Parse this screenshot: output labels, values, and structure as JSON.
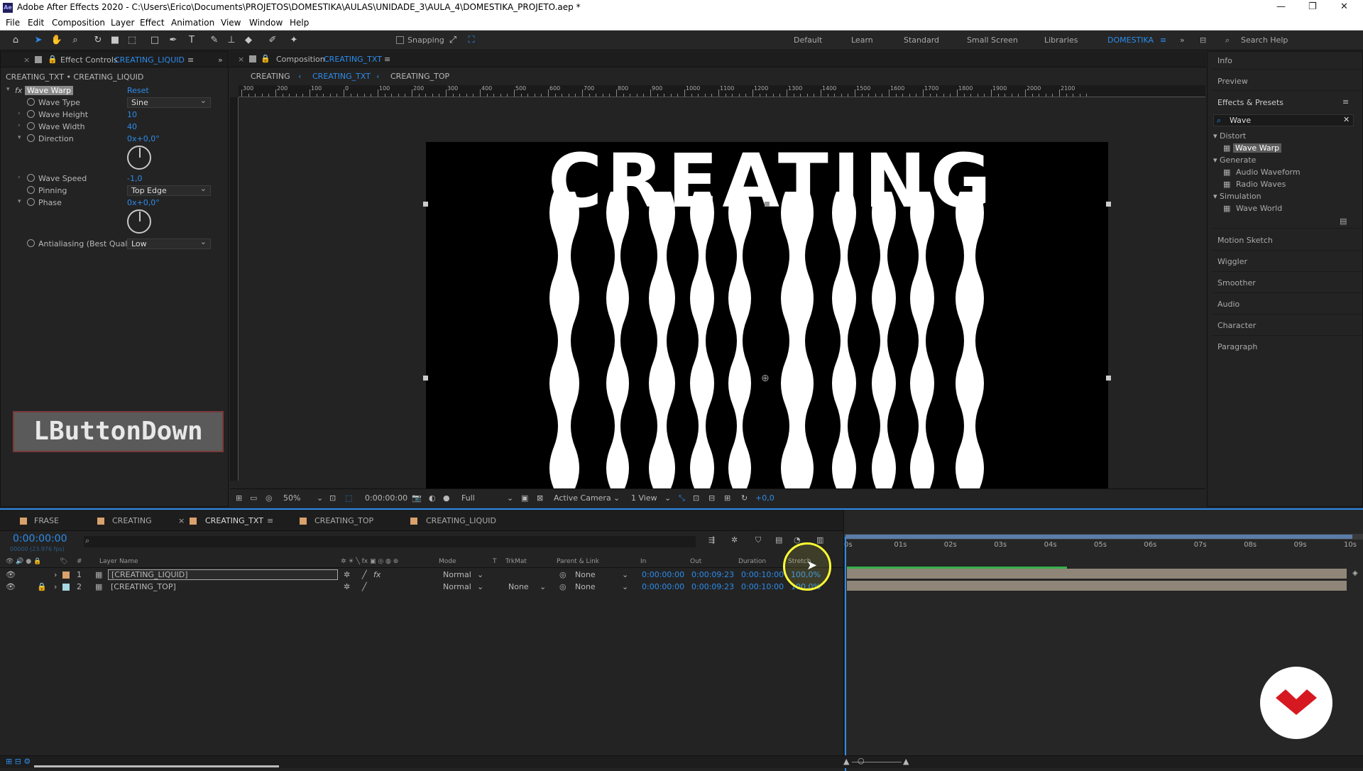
{
  "app": {
    "title": "Adobe After Effects 2020 - C:\\Users\\Erico\\Documents\\PROJETOS\\DOMESTIKA\\AULAS\\UNIDADE_3\\AULA_4\\DOMESTIKA_PROJETO.aep *",
    "icon_label": "Ae"
  },
  "menu": [
    "File",
    "Edit",
    "Composition",
    "Layer",
    "Effect",
    "Animation",
    "View",
    "Window",
    "Help"
  ],
  "toolbar": {
    "snapping": "Snapping",
    "workspaces": [
      "Default",
      "Learn",
      "Standard",
      "Small Screen",
      "Libraries",
      "DOMESTIKA"
    ],
    "search_help": "Search Help"
  },
  "effect_controls": {
    "tab_prefix": "Effect Controls",
    "tab_layer": "CREATING_LIQUID",
    "header": "CREATING_TXT • CREATING_LIQUID",
    "effect_name": "Wave Warp",
    "reset": "Reset",
    "fx": "fx",
    "props": [
      {
        "label": "Wave Type",
        "value": "Sine"
      },
      {
        "label": "Wave Height",
        "value": "10"
      },
      {
        "label": "Wave Width",
        "value": "40"
      },
      {
        "label": "Direction",
        "value": "0x+0,0°"
      },
      {
        "label": "Wave Speed",
        "value": "-1,0"
      },
      {
        "label": "Pinning",
        "value": "Top Edge"
      },
      {
        "label": "Phase",
        "value": "0x+0,0°"
      },
      {
        "label": "Antialiasing (Best Quali",
        "value": "Low"
      }
    ]
  },
  "overlay_label": "LButtonDown",
  "composition": {
    "tab_prefix": "Composition",
    "tab_name": "CREATING_TXT",
    "breadcrumbs": [
      "CREATING",
      "CREATING_TXT",
      "CREATING_TOP"
    ],
    "ruler_labels": [
      "300",
      "200",
      "100",
      "0",
      "100",
      "200",
      "300",
      "400",
      "500",
      "600",
      "700",
      "800",
      "900",
      "1000",
      "1100",
      "1200",
      "1300",
      "1400",
      "1500",
      "1600",
      "1700",
      "1800",
      "1900",
      "2000",
      "2100"
    ],
    "canvas_text": "CREATING",
    "viewer_bar": {
      "zoom": "50%",
      "timecode": "0:00:00:00",
      "resolution": "Full",
      "camera": "Active Camera",
      "views": "1 View",
      "exposure": "+0,0"
    }
  },
  "right_panel": {
    "info": "Info",
    "preview": "Preview",
    "effects_presets": "Effects & Presets",
    "search": "Wave",
    "tree": [
      {
        "category": "Distort",
        "items": [
          "Wave Warp"
        ]
      },
      {
        "category": "Generate",
        "items": [
          "Audio Waveform",
          "Radio Waves"
        ]
      },
      {
        "category": "Simulation",
        "items": [
          "Wave World"
        ]
      }
    ],
    "panels": [
      "Motion Sketch",
      "Wiggler",
      "Smoother",
      "Audio",
      "Character",
      "Paragraph"
    ]
  },
  "timeline": {
    "tabs": [
      "FRASE",
      "CREATING",
      "CREATING_TXT",
      "CREATING_TOP",
      "CREATING_LIQUID"
    ],
    "current_time": "0:00:00:00",
    "fps": "00000 (23.976 fps)",
    "columns": [
      "#",
      "Layer Name",
      "Mode",
      "T",
      "TrkMat",
      "Parent & Link",
      "In",
      "Out",
      "Duration",
      "Stretch"
    ],
    "layers": [
      {
        "num": "1",
        "name": "[CREATING_LIQUID]",
        "mode": "Normal",
        "trkmat": "",
        "parent": "None",
        "in": "0:00:00:00",
        "out": "0:00:09:23",
        "duration": "0:00:10:00",
        "stretch": "100,0%",
        "color": "#d9a16c"
      },
      {
        "num": "2",
        "name": "[CREATING_TOP]",
        "mode": "Normal",
        "trkmat": "None",
        "parent": "None",
        "in": "0:00:00:00",
        "out": "0:00:09:23",
        "duration": "0:00:10:00",
        "stretch": "100,0%",
        "color": "#a6d7e3"
      }
    ],
    "ruler": [
      "0s",
      "01s",
      "02s",
      "03s",
      "04s",
      "05s",
      "06s",
      "07s",
      "08s",
      "09s",
      "10s"
    ],
    "duration_s": 10,
    "work_area_green_end_s": 4.4
  },
  "colors": {
    "accent": "#2d8ceb",
    "layer_bar": "#8f8679",
    "highlight": "#ffff33"
  }
}
